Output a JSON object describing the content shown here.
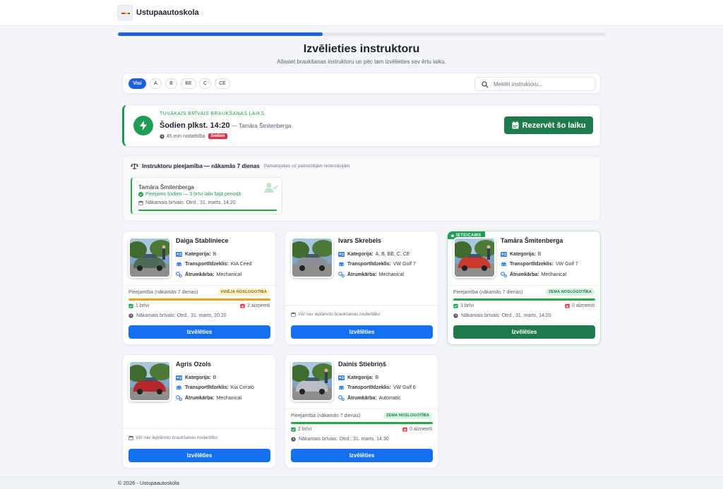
{
  "app": {
    "brand_name": "Ustupaautoskola"
  },
  "wizard": {
    "progress": 0.42
  },
  "page": {
    "title": "Izvēlieties instruktoru",
    "subtitle": "Atlasiet braukšanas instruktoru un pēc tam izvēlieties sev ērtu laiku."
  },
  "filters": {
    "chips": [
      "Visi",
      "A",
      "B",
      "BE",
      "C",
      "CE"
    ],
    "active": "Visi",
    "search_placeholder": "Meklēt instruktoru..."
  },
  "nearest": {
    "label": "Tuvākais brīvais braukšanas laiks",
    "time": "Šodien plkst. 14:20",
    "instructor": "— Tamāra Šmitenberga",
    "duration": "45 min nodarbība",
    "badge": "Šodien",
    "reserve_button": "Rezervēt šo laiku"
  },
  "overview": {
    "title": "Instruktoru pieejamība — nākamās 7 dienas",
    "note": "Pamatojoties uz pašreizējām rezervācijām",
    "card": {
      "name": "Tamāra Šmitenberga",
      "status": "Pieejams šodien — 3 brīvi laiki šajā periodā",
      "next": "Nākamais brīvais: Otrd., 31. marts, 14:20",
      "fill": 1.0
    }
  },
  "labels": {
    "category": "Kategorija:",
    "vehicle": "Transportlīdzeklis:",
    "gearbox": "Ātrumkārba:",
    "availability": "Pieejamība (nākamās 7 dienas)",
    "choose": "Izvēlēties",
    "recommended": "IETEICAMS",
    "no_lessons": "Vēl nav ieplānotu braukšanas nodarbību"
  },
  "instructors": [
    {
      "name": "Daiga Stabliniece",
      "category": "B",
      "vehicle": "KIA Ceed",
      "gearbox": "Mechanical",
      "load_badge": "VIDĒJA NOSLOGOTĪBA",
      "load_level": "mid",
      "load_fill": 1.0,
      "free": "1 brīvi",
      "busy": "2 aizņemti",
      "next": "Nākamais brīvais: Otrd., 31. marts, 20:20",
      "car_color": "#4f6b57"
    },
    {
      "name": "Ivars Skrebels",
      "category": "A, B, BE, C, CE",
      "vehicle": "VW Golf 7",
      "gearbox": "Mechanical",
      "car_color": "#8c9096"
    },
    {
      "name": "Tamāra Šmitenberga",
      "category": "B",
      "vehicle": "VW Golf 7",
      "gearbox": "Mechanical",
      "recommended": true,
      "load_badge": "ZEMA NOSLOGOTĪBA",
      "load_level": "low",
      "load_fill": 1.0,
      "free": "3 brīvi",
      "busy": "0 aizņemti",
      "next": "Nākamais brīvais: Otrd., 31. marts, 14:20",
      "car_color": "#c8392e"
    },
    {
      "name": "Agris Ozols",
      "category": "B",
      "vehicle": "Kia Cerato",
      "gearbox": "Mechanical",
      "car_color": "#b3282a"
    },
    {
      "name": "Dainis Stiebriņš",
      "category": "B",
      "vehicle": "VW Golf 6",
      "gearbox": "Automatic",
      "load_badge": "ZEMA NOSLOGOTĪBA",
      "load_level": "low",
      "load_fill": 1.0,
      "free": "2 brīvi",
      "busy": "0 aizņemti",
      "next": "Nākamais brīvais: Otrd., 31. marts, 14:30",
      "car_color": "#b9bec4"
    }
  ],
  "footer": {
    "text": "© 2026 - Ustupaautoskola"
  },
  "colors": {
    "primary": "#1570ef",
    "success": "#1f9d55",
    "success_dark": "#1f7a4d",
    "warning": "#f0a020",
    "danger": "#dc3545"
  }
}
